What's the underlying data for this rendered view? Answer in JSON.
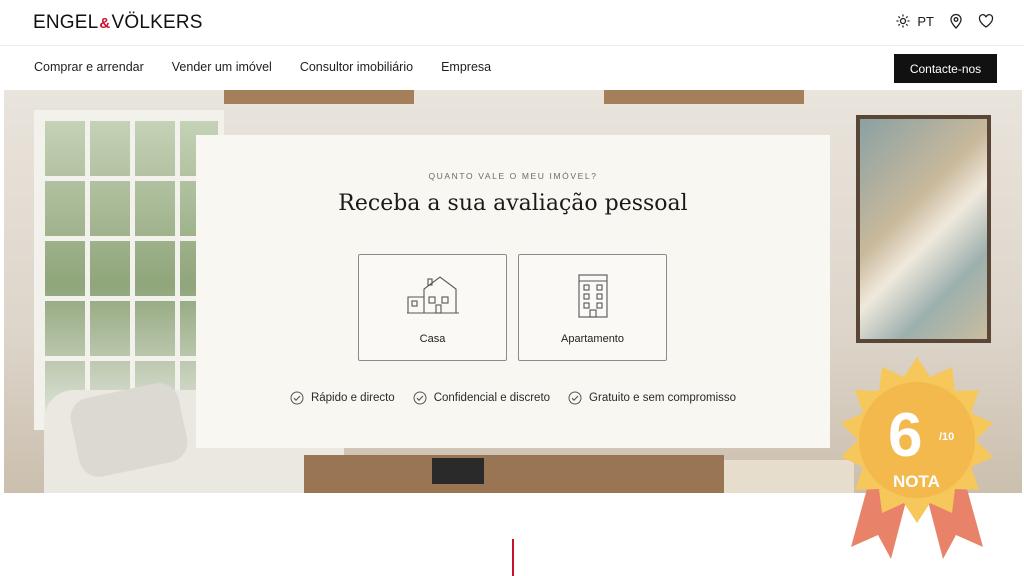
{
  "brand": {
    "logo_left": "ENGEL",
    "logo_amp": "&",
    "logo_right": "VÖLKERS",
    "accent": "#c8102e"
  },
  "top": {
    "language": "PT",
    "icons": [
      "gear-icon",
      "location-icon",
      "heart-icon"
    ]
  },
  "nav": {
    "items": [
      "Comprar e arrendar",
      "Vender um imóvel",
      "Consultor imobiliário",
      "Empresa"
    ],
    "contact_label": "Contacte-nos"
  },
  "valuation": {
    "eyebrow": "QUANTO VALE O MEU IMÓVEL?",
    "title": "Receba a sua avaliação pessoal",
    "options": [
      {
        "label": "Casa",
        "icon": "house-icon"
      },
      {
        "label": "Apartamento",
        "icon": "apartment-icon"
      }
    ],
    "features": [
      "Rápido e directo",
      "Confidencial e discreto",
      "Gratuito e sem compromisso"
    ]
  },
  "badge": {
    "score": "6",
    "out_of": "/10",
    "label": "NOTA",
    "colors": {
      "star": "#f6c75a",
      "ribbon": "#e8836a"
    }
  }
}
